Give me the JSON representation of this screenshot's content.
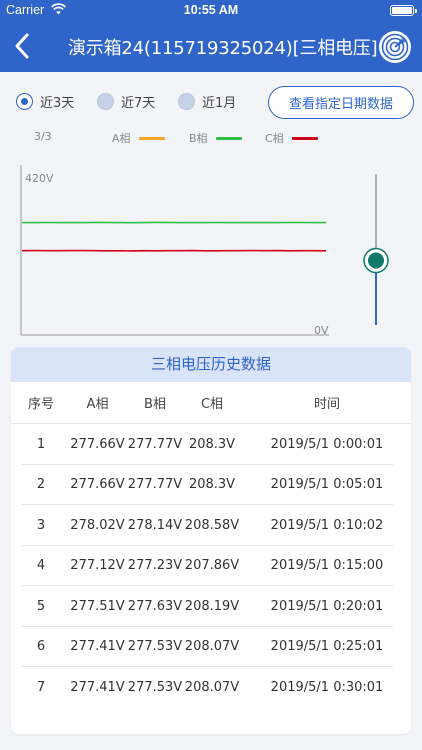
{
  "status_bar": {
    "carrier": "Carrier",
    "time": "10:55 AM"
  },
  "nav": {
    "title": "演示箱24(115719325024)[三相电压]"
  },
  "filters": {
    "options": [
      {
        "label": "近3天",
        "selected": true
      },
      {
        "label": "近7天",
        "selected": false
      },
      {
        "label": "近1月",
        "selected": false
      }
    ],
    "date_button": "查看指定日期数据"
  },
  "legend": {
    "page": "3/3",
    "items": [
      {
        "label": "A相",
        "color": "#f5a623"
      },
      {
        "label": "B相",
        "color": "#2dbf47"
      },
      {
        "label": "C相",
        "color": "#d0021b"
      }
    ]
  },
  "colors": {
    "accent": "#2f64c8",
    "slider": "#0f7a6a"
  },
  "chart_data": {
    "type": "line",
    "ylim": [
      0,
      420
    ],
    "ytick_labels": [
      "420V",
      "0V"
    ],
    "series": [
      {
        "name": "B相",
        "color": "#2dbf47",
        "values": [
          277.8,
          277.8,
          277.9,
          277.7,
          277.6,
          277.8,
          278.2,
          277.9,
          277.7,
          277.5,
          277.6,
          278.1,
          277.9,
          277.8,
          277.7,
          277.8,
          277.9,
          277.6,
          277.6,
          277.7,
          277.8,
          277.7,
          278.0,
          277.9,
          277.8,
          277.7
        ]
      },
      {
        "name": "C相",
        "color": "#d0021b",
        "values": [
          208.3,
          208.4,
          208.2,
          208.3,
          208.6,
          208.5,
          208.2,
          207.9,
          208.0,
          207.8,
          208.3,
          208.1,
          208.2,
          208.3,
          208.5,
          208.1,
          208.0,
          208.2,
          208.3,
          208.6,
          208.2,
          208.4,
          208.1,
          208.3,
          208.2,
          208.1
        ]
      }
    ],
    "slider_value": 0.5
  },
  "table": {
    "title": "三相电压历史数据",
    "headers": [
      "序号",
      "A相",
      "B相",
      "C相",
      "时间"
    ],
    "rows": [
      [
        "1",
        "277.66V",
        "277.77V",
        "208.3V",
        "2019/5/1 0:00:01"
      ],
      [
        "2",
        "277.66V",
        "277.77V",
        "208.3V",
        "2019/5/1 0:05:01"
      ],
      [
        "3",
        "278.02V",
        "278.14V",
        "208.58V",
        "2019/5/1 0:10:02"
      ],
      [
        "4",
        "277.12V",
        "277.23V",
        "207.86V",
        "2019/5/1 0:15:00"
      ],
      [
        "5",
        "277.51V",
        "277.63V",
        "208.19V",
        "2019/5/1 0:20:01"
      ],
      [
        "6",
        "277.41V",
        "277.53V",
        "208.07V",
        "2019/5/1 0:25:01"
      ],
      [
        "7",
        "277.41V",
        "277.53V",
        "208.07V",
        "2019/5/1 0:30:01"
      ]
    ]
  }
}
